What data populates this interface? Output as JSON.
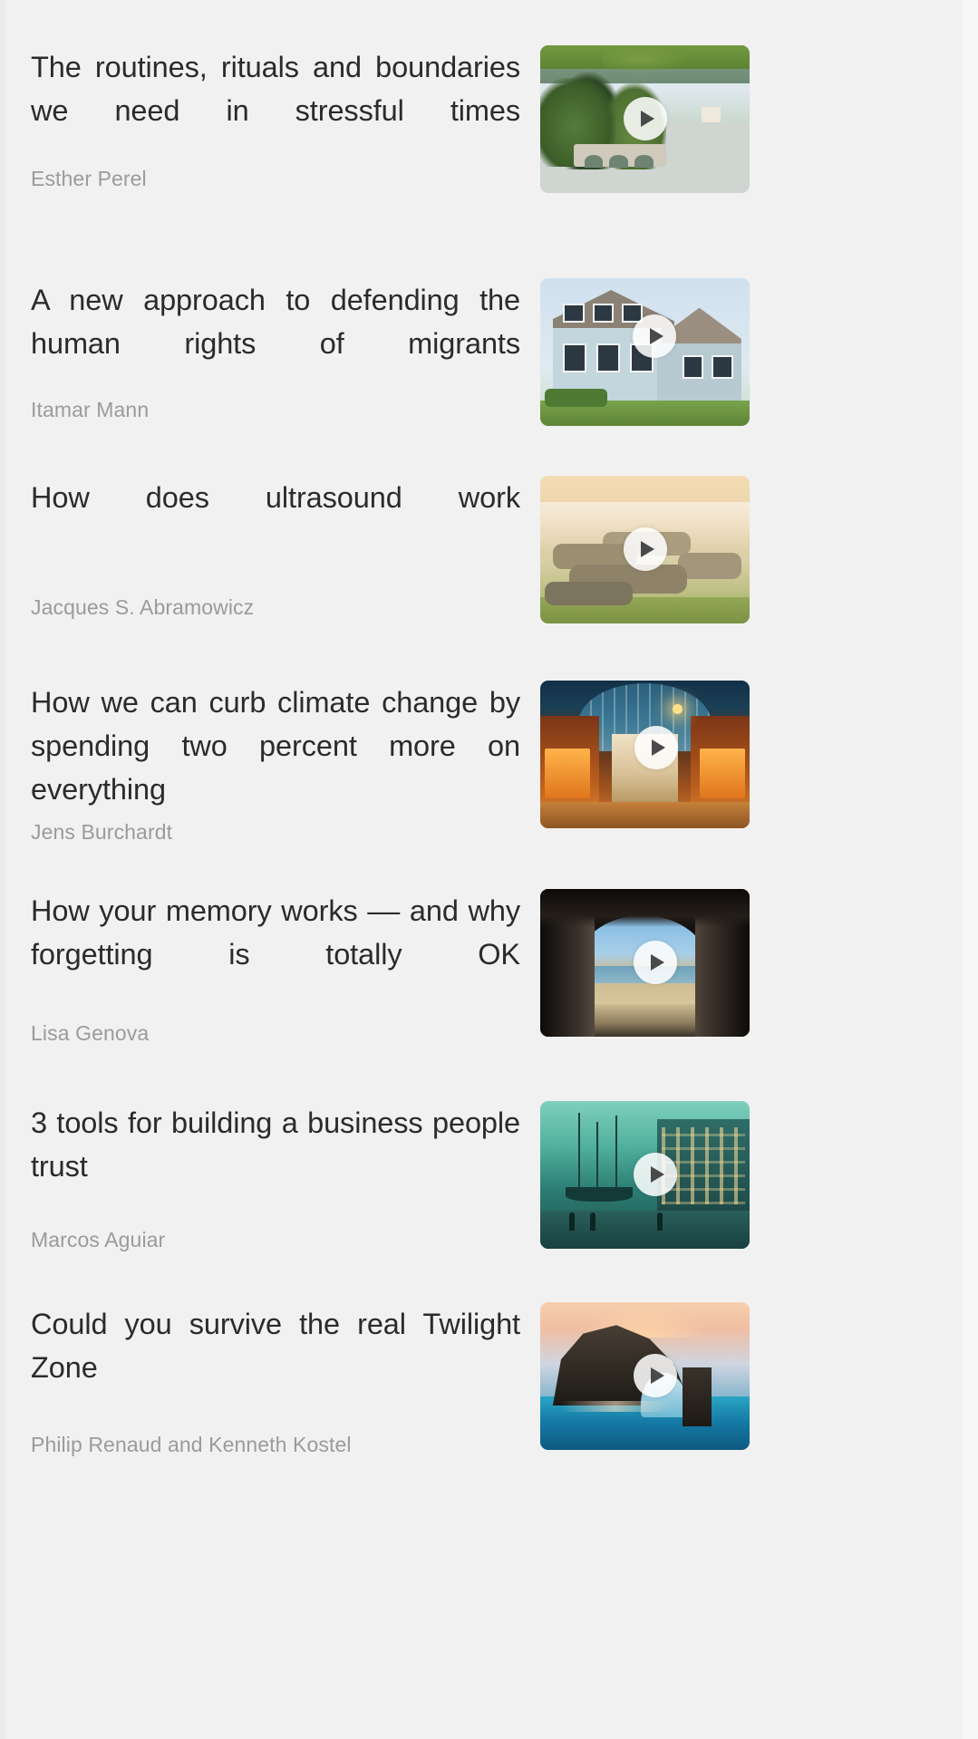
{
  "page": {
    "background_color": "#f1f1f1",
    "title_color": "#2b2b2b",
    "author_color": "#9b9b9b",
    "play_icon_name": "play-icon"
  },
  "talks": [
    {
      "title": "The routines, rituals and boundaries we need in stressful times",
      "author": "Esther Perel",
      "thumbnail_alt": "parkland with stone bridge over a lake",
      "play_label": "Play"
    },
    {
      "title": "A new approach to defending the human rights of migrants",
      "author": "Itamar Mann",
      "thumbnail_alt": "pale blue clapboard house with thatched roof",
      "play_label": "Play"
    },
    {
      "title": "How does ultrasound work",
      "author": "Jacques S. Abramowicz",
      "thumbnail_alt": "misty granite tor rock formation at dawn",
      "play_label": "Play"
    },
    {
      "title": "How we can curb climate change by spending two percent more on everything",
      "author": "Jens Burchardt",
      "thumbnail_alt": "victorian glass roofed shopping arcade lit at night",
      "play_label": "Play"
    },
    {
      "title": "How your memory works –– and why forgetting is totally OK",
      "author": "Lisa Genova",
      "thumbnail_alt": "view out of a dark sea cave onto a sandy beach",
      "play_label": "Play"
    },
    {
      "title": "3 tools for building a business people trust",
      "author": "Marcos Aguiar",
      "thumbnail_alt": "teal toned harbour at dusk with tall ships",
      "play_label": "Play"
    },
    {
      "title": "Could you survive the real Twilight Zone",
      "author": "Philip Renaud and Kenneth Kostel",
      "thumbnail_alt": "sea arch rock formation at sunset over turquoise water",
      "play_label": "Play"
    }
  ]
}
